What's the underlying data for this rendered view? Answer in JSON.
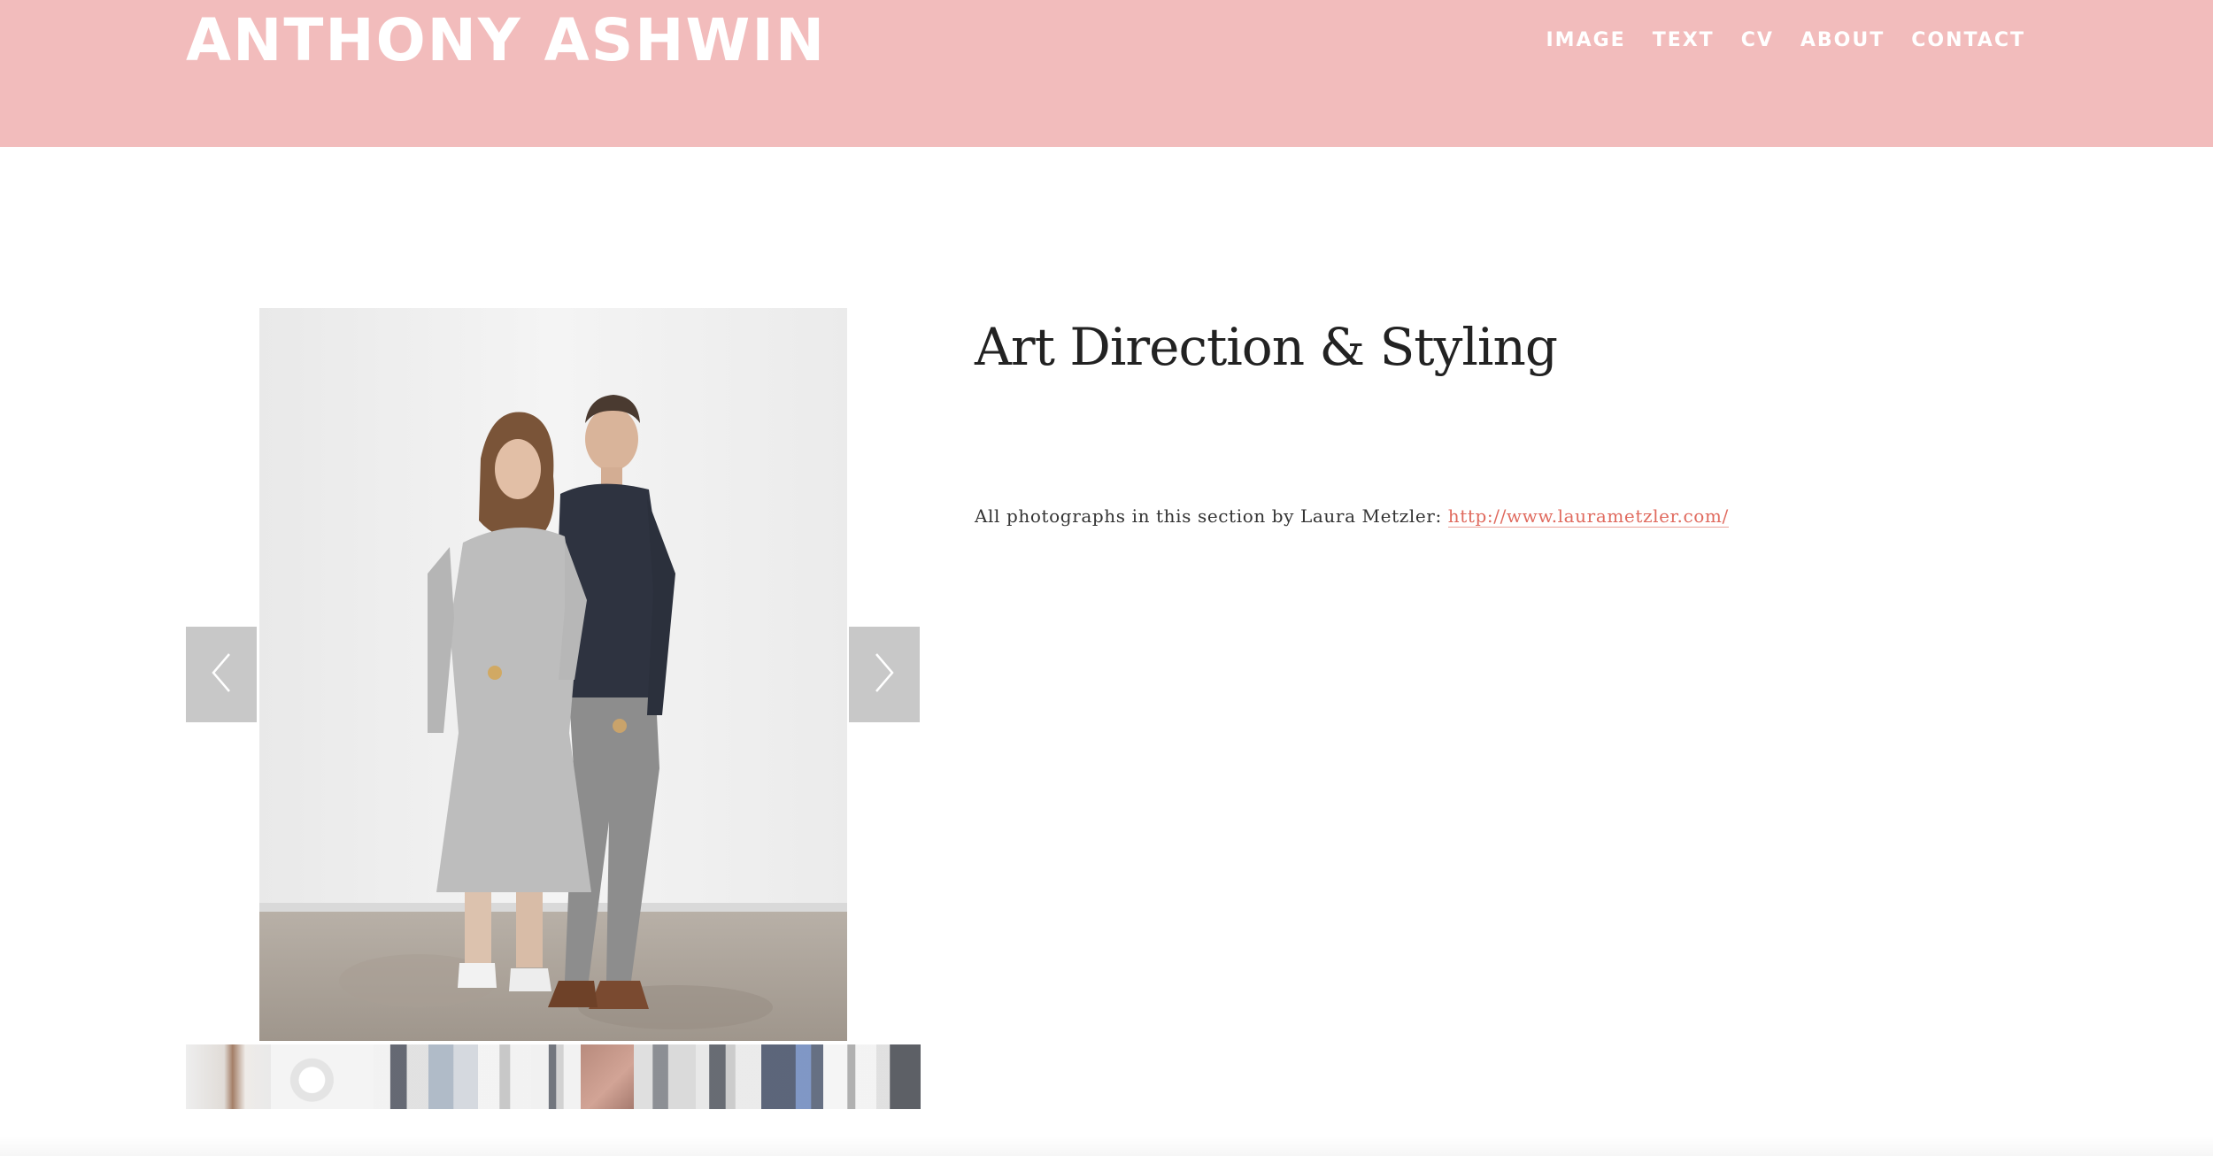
{
  "site": {
    "title": "ANTHONY ASHWIN",
    "header_color": "#f2bcbc"
  },
  "nav": {
    "items": [
      {
        "label": "IMAGE"
      },
      {
        "label": "TEXT"
      },
      {
        "label": "CV"
      },
      {
        "label": "ABOUT"
      },
      {
        "label": "CONTACT"
      }
    ]
  },
  "gallery": {
    "prev_icon": "chevron-left-icon",
    "next_icon": "chevron-right-icon",
    "thumbnail_count": 12
  },
  "content": {
    "title": "Art Direction & Styling",
    "credit_text": "All photographs in this section by Laura Metzler: ",
    "credit_link": "http://www.laurametzler.com/",
    "link_color": "#e06a5e"
  }
}
